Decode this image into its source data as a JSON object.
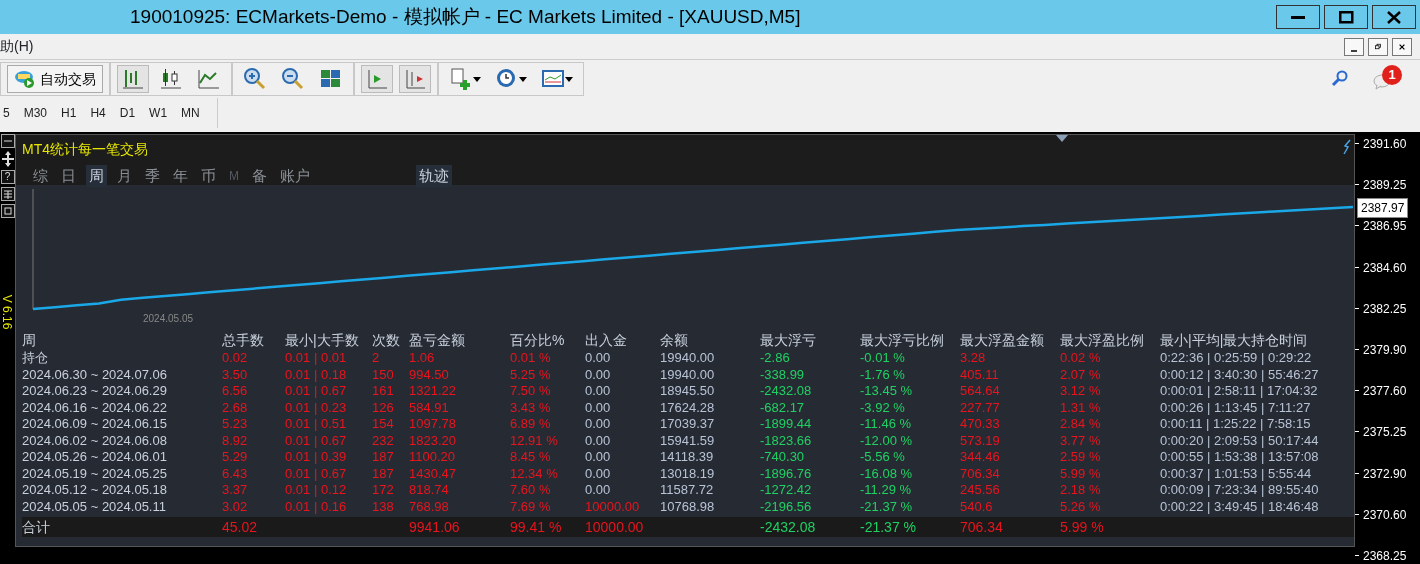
{
  "window": {
    "title": "190010925: ECMarkets-Demo - 模拟帐户 - EC Markets Limited - [XAUUSD,M5]"
  },
  "menu": [
    "助(H)"
  ],
  "toolbar": {
    "autotrade_label": "自动交易",
    "notification_count": "1"
  },
  "timeframes": [
    {
      "label": "5",
      "selected": false
    },
    {
      "label": "M30",
      "selected": false
    },
    {
      "label": "H1",
      "selected": false
    },
    {
      "label": "H4",
      "selected": false
    },
    {
      "label": "D1",
      "selected": false
    },
    {
      "label": "W1",
      "selected": false
    },
    {
      "label": "MN",
      "selected": false
    }
  ],
  "side_strip": {
    "help": "?",
    "version": "V 6.16"
  },
  "panel": {
    "title": "MT4统计每一笔交易",
    "tabs": [
      {
        "label": "综",
        "selected": false,
        "disabled": false
      },
      {
        "label": "日",
        "selected": false,
        "disabled": false
      },
      {
        "label": "周",
        "selected": true,
        "disabled": false
      },
      {
        "label": "月",
        "selected": false,
        "disabled": false
      },
      {
        "label": "季",
        "selected": false,
        "disabled": false
      },
      {
        "label": "年",
        "selected": false,
        "disabled": false
      },
      {
        "label": "币",
        "selected": false,
        "disabled": false
      },
      {
        "label": "M",
        "selected": false,
        "disabled": true
      },
      {
        "label": "备",
        "selected": false,
        "disabled": false
      },
      {
        "label": "账户",
        "selected": false,
        "disabled": false
      }
    ],
    "trace_button": {
      "label": "轨迹",
      "on": true
    },
    "curve_start_label": "2024.05.05",
    "table": {
      "columns": [
        {
          "label": "周",
          "color": "#c8d0dc"
        },
        {
          "label": "总手数",
          "color": "#e8141e"
        },
        {
          "label": "最小|大手数",
          "color": "#e8141e"
        },
        {
          "label": "次数",
          "color": "#e8141e"
        },
        {
          "label": "盈亏金额",
          "color": "#e8141e"
        },
        {
          "label": "百分比%",
          "color": "#e8141e"
        },
        {
          "label": "出入金",
          "color": "#b8c3d6"
        },
        {
          "label": "余额",
          "color": "#b8c3d6"
        },
        {
          "label": "最大浮亏",
          "color": "#1fd163"
        },
        {
          "label": "最大浮亏比例",
          "color": "#1fd163"
        },
        {
          "label": "最大浮盈金额",
          "color": "#e8141e"
        },
        {
          "label": "最大浮盈比例",
          "color": "#e8141e"
        },
        {
          "label": "最小|平均|最大持仓时间",
          "color": "#b8c3d6"
        }
      ],
      "rows": [
        {
          "cells": [
            "持仓",
            "0.02",
            "0.01 | 0.01",
            "2",
            "1.06",
            "0.01 %",
            "0.00",
            "19940.00",
            "-2.86",
            "-0.01 %",
            "3.28",
            "0.02 %",
            "0:22:36 | 0:25:59 | 0:29:22"
          ],
          "deposit_flag": false
        },
        {
          "cells": [
            "2024.06.30 ~ 2024.07.06",
            "3.50",
            "0.01 | 0.18",
            "150",
            "994.50",
            "5.25 %",
            "0.00",
            "19940.00",
            "-338.99",
            "-1.76 %",
            "405.11",
            "2.07 %",
            "0:00:12 | 3:40:30 | 55:46:27"
          ],
          "deposit_flag": false
        },
        {
          "cells": [
            "2024.06.23 ~ 2024.06.29",
            "6.56",
            "0.01 | 0.67",
            "161",
            "1321.22",
            "7.50 %",
            "0.00",
            "18945.50",
            "-2432.08",
            "-13.45 %",
            "564.64",
            "3.12 %",
            "0:00:01 | 2:58:11 | 17:04:32"
          ],
          "deposit_flag": false
        },
        {
          "cells": [
            "2024.06.16 ~ 2024.06.22",
            "2.68",
            "0.01 | 0.23",
            "126",
            "584.91",
            "3.43 %",
            "0.00",
            "17624.28",
            "-682.17",
            "-3.92 %",
            "227.77",
            "1.31 %",
            "0:00:26 | 1:13:45 | 7:11:27"
          ],
          "deposit_flag": false
        },
        {
          "cells": [
            "2024.06.09 ~ 2024.06.15",
            "5.23",
            "0.01 | 0.51",
            "154",
            "1097.78",
            "6.89 %",
            "0.00",
            "17039.37",
            "-1899.44",
            "-11.46 %",
            "470.33",
            "2.84 %",
            "0:00:11 | 1:25:22 | 7:58:15"
          ],
          "deposit_flag": false
        },
        {
          "cells": [
            "2024.06.02 ~ 2024.06.08",
            "8.92",
            "0.01 | 0.67",
            "232",
            "1823.20",
            "12.91 %",
            "0.00",
            "15941.59",
            "-1823.66",
            "-12.00 %",
            "573.19",
            "3.77 %",
            "0:00:20 | 2:09:53 | 50:17:44"
          ],
          "deposit_flag": false
        },
        {
          "cells": [
            "2024.05.26 ~ 2024.06.01",
            "5.29",
            "0.01 | 0.39",
            "187",
            "1100.20",
            "8.45 %",
            "0.00",
            "14118.39",
            "-740.30",
            "-5.56 %",
            "344.46",
            "2.59 %",
            "0:00:55 | 1:53:38 | 13:57:08"
          ],
          "deposit_flag": false
        },
        {
          "cells": [
            "2024.05.19 ~ 2024.05.25",
            "6.43",
            "0.01 | 0.67",
            "187",
            "1430.47",
            "12.34 %",
            "0.00",
            "13018.19",
            "-1896.76",
            "-16.08 %",
            "706.34",
            "5.99 %",
            "0:00:37 | 1:01:53 | 5:55:44"
          ],
          "deposit_flag": false
        },
        {
          "cells": [
            "2024.05.12 ~ 2024.05.18",
            "3.37",
            "0.01 | 0.12",
            "172",
            "818.74",
            "7.60 %",
            "0.00",
            "11587.72",
            "-1272.42",
            "-11.29 %",
            "245.56",
            "2.18 %",
            "0:00:09 | 7:23:34 | 89:55:40"
          ],
          "deposit_flag": false
        },
        {
          "cells": [
            "2024.05.05 ~ 2024.05.11",
            "3.02",
            "0.01 | 0.16",
            "138",
            "768.98",
            "7.69 %",
            "10000.00",
            "10768.98",
            "-2196.56",
            "-21.37 %",
            "540.6",
            "5.26 %",
            "0:00:22 | 3:49:45 | 18:46:48"
          ],
          "deposit_flag": true
        }
      ],
      "total": {
        "cells": [
          "合计",
          "45.02",
          null,
          null,
          "9941.06",
          "99.41 %",
          "10000.00",
          null,
          "-2432.08",
          "-21.37 %",
          "706.34",
          "5.99 %",
          null
        ],
        "deposit_flag": true
      }
    }
  },
  "price_axis": {
    "ticks": [
      "2391.60",
      "2389.25",
      "2386.95",
      "2384.60",
      "2382.25",
      "2379.90",
      "2377.60",
      "2375.25",
      "2372.90",
      "2370.60",
      "2368.25"
    ],
    "current": "2387.97"
  }
}
